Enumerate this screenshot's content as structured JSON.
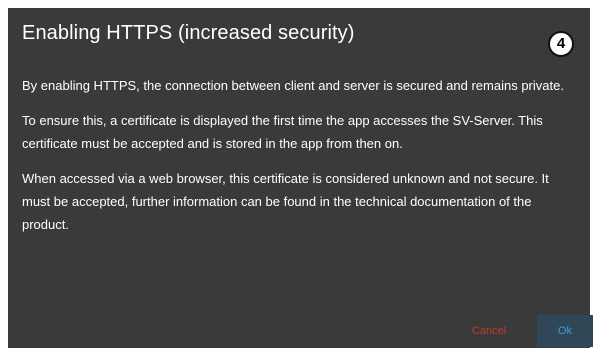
{
  "dialog": {
    "title": "Enabling HTTPS (increased security)",
    "step_badge": "4",
    "paragraphs": [
      "By enabling HTTPS, the connection between client and server is secured and remains private.",
      "To ensure this, a certificate is displayed the first time the app accesses the SV-Server. This certificate must be accepted and is stored in the app from then on.",
      "When accessed via a web browser, this certificate is considered unknown and not secure. It must be accepted, further information can be found in the technical documentation of the product."
    ],
    "cancel_label": "Cancel",
    "ok_label": "Ok"
  },
  "colors": {
    "dialog_background": "#3a3a3a",
    "cancel_text": "#c0392b",
    "ok_background": "#2f4756",
    "ok_text": "#3aa3dd"
  }
}
